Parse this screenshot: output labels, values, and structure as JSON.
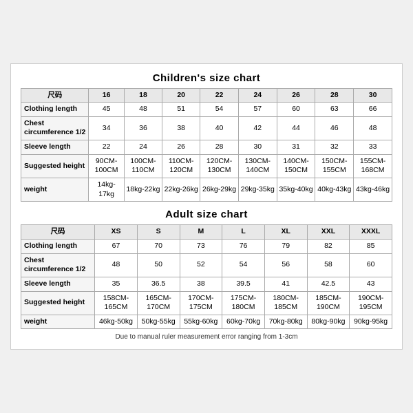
{
  "children_chart": {
    "title": "Children's size chart",
    "headers": [
      "尺码",
      "16",
      "18",
      "20",
      "22",
      "24",
      "26",
      "28",
      "30"
    ],
    "rows": [
      {
        "label": "Clothing length",
        "values": [
          "45",
          "48",
          "51",
          "54",
          "57",
          "60",
          "63",
          "66"
        ]
      },
      {
        "label": "Chest circumference 1/2",
        "values": [
          "34",
          "36",
          "38",
          "40",
          "42",
          "44",
          "46",
          "48"
        ]
      },
      {
        "label": "Sleeve length",
        "values": [
          "22",
          "24",
          "26",
          "28",
          "30",
          "31",
          "32",
          "33"
        ]
      },
      {
        "label": "Suggested height",
        "values": [
          "90CM-100CM",
          "100CM-110CM",
          "110CM-120CM",
          "120CM-130CM",
          "130CM-140CM",
          "140CM-150CM",
          "150CM-155CM",
          "155CM-168CM"
        ]
      },
      {
        "label": "weight",
        "values": [
          "14kg-17kg",
          "18kg-22kg",
          "22kg-26kg",
          "26kg-29kg",
          "29kg-35kg",
          "35kg-40kg",
          "40kg-43kg",
          "43kg-46kg"
        ]
      }
    ]
  },
  "adult_chart": {
    "title": "Adult size chart",
    "headers": [
      "尺码",
      "XS",
      "S",
      "M",
      "L",
      "XL",
      "XXL",
      "XXXL"
    ],
    "rows": [
      {
        "label": "Clothing length",
        "values": [
          "67",
          "70",
          "73",
          "76",
          "79",
          "82",
          "85"
        ]
      },
      {
        "label": "Chest circumference 1/2",
        "values": [
          "48",
          "50",
          "52",
          "54",
          "56",
          "58",
          "60"
        ]
      },
      {
        "label": "Sleeve length",
        "values": [
          "35",
          "36.5",
          "38",
          "39.5",
          "41",
          "42.5",
          "43"
        ]
      },
      {
        "label": "Suggested height",
        "values": [
          "158CM-165CM",
          "165CM-170CM",
          "170CM-175CM",
          "175CM-180CM",
          "180CM-185CM",
          "185CM-190CM",
          "190CM-195CM"
        ]
      },
      {
        "label": "weight",
        "values": [
          "46kg-50kg",
          "50kg-55kg",
          "55kg-60kg",
          "60kg-70kg",
          "70kg-80kg",
          "80kg-90kg",
          "90kg-95kg"
        ]
      }
    ]
  },
  "footnote": "Due to manual ruler measurement error ranging from 1-3cm"
}
